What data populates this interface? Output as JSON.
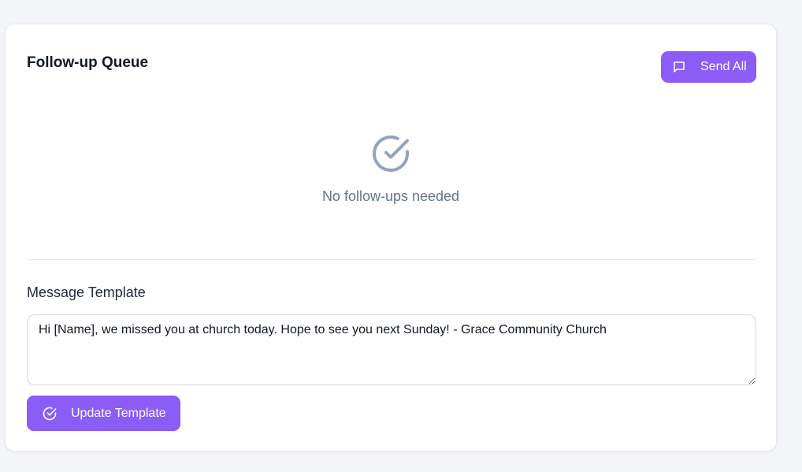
{
  "queue": {
    "title": "Follow-up Queue",
    "send_all_label": "Send All",
    "send_all_icon": "message-icon",
    "empty_icon": "check-circle-icon",
    "empty_text": "No follow-ups needed"
  },
  "template": {
    "label": "Message Template",
    "value": "Hi [Name], we missed you at church today. Hope to see you next Sunday! - Grace Community Church",
    "update_label": "Update Template",
    "update_icon": "check-circle-icon"
  },
  "colors": {
    "accent": "#8b5cf6",
    "muted": "#64748b",
    "icon": "#94a3b8"
  }
}
